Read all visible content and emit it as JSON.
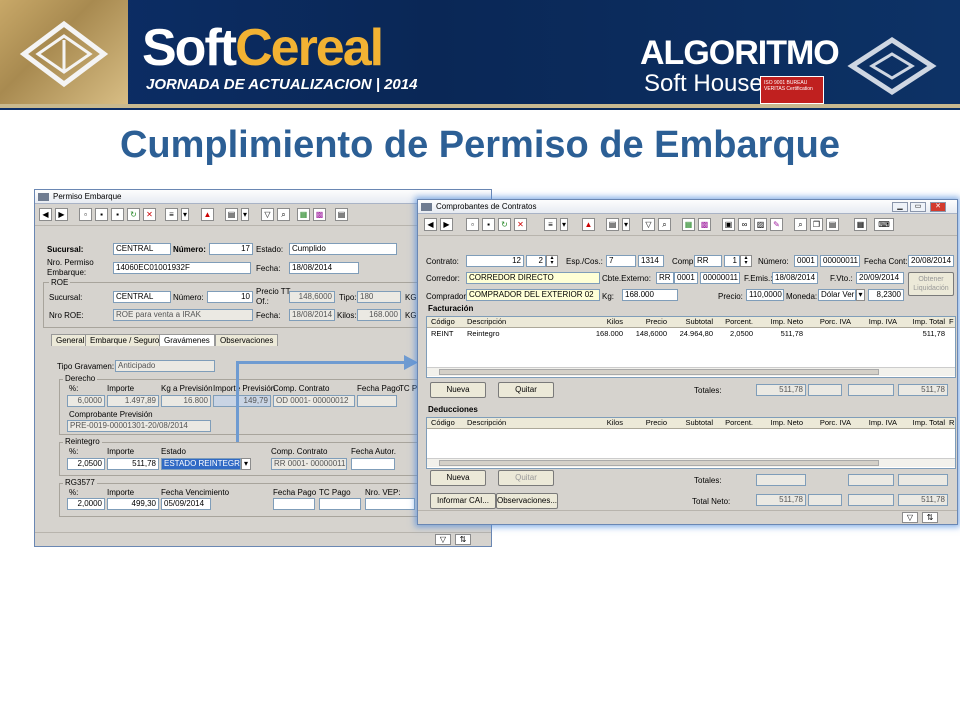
{
  "banner": {
    "brand_soft": "Soft",
    "brand_cereal": "Cereal",
    "subtitle": "JORNADA DE ACTUALIZACION | 2014",
    "partner_name": "ALGORITMO",
    "partner_sub": "Soft House",
    "iso_text": "ISO 9001 BUREAU VERITAS Certification"
  },
  "page_title": "Cumplimiento de Permiso de Embarque",
  "permiso": {
    "title": "Permiso Embarque",
    "sucursal_label": "Sucursal:",
    "sucursal_value": "CENTRAL",
    "numero_label": "Número:",
    "numero_value": "17",
    "estado_label": "Estado:",
    "estado_value": "Cumplido",
    "nro_permiso_label": "Nro. Permiso Embarque:",
    "nro_permiso_value": "14060EC01001932F",
    "fecha_label": "Fecha:",
    "fecha_value": "18/08/2014",
    "roe": {
      "group_label": "ROE",
      "sucursal_label": "Sucursal:",
      "sucursal_value": "CENTRAL",
      "numero_label": "Número:",
      "numero_value": "10",
      "precio_label": "Precio TT Of.:",
      "precio_value": "148,6000",
      "tipo_label": "Tipo:",
      "tipo_value": "180",
      "kg_label": "KG",
      "nro_label": "Nro ROE:",
      "nro_value": "ROE para venta a IRAK",
      "fecha_label": "Fecha:",
      "fecha_value": "18/08/2014",
      "kilos_label": "Kilos:",
      "kilos_value": "168.000",
      "kg2_label": "KG"
    },
    "tabs": [
      "General",
      "Embarque / Seguro",
      "Gravámenes",
      "Observaciones"
    ],
    "tipo_gravamen_label": "Tipo Gravamen:",
    "tipo_gravamen_value": "Anticipado",
    "derecho": {
      "label": "Derecho",
      "headers": [
        "%:",
        "Importe",
        "Kg a Previsión",
        "Importe Previsión",
        "Comp. Contrato",
        "Fecha Pago",
        "TC P"
      ],
      "row": [
        "6,0000",
        "1.497,89",
        "16.800",
        "149,79",
        "OD  0001- 00000012",
        "",
        ""
      ],
      "comp_prev_label": "Comprobante Previsión",
      "comp_prev_value": "PRE-0019-00001301-20/08/2014"
    },
    "reintegro": {
      "label": "Reintegro",
      "headers": [
        "%:",
        "Importe",
        "Estado",
        "Comp. Contrato",
        "Fecha Autor."
      ],
      "row": [
        "2,0500",
        "511,78",
        "ESTADO REINTEGRO",
        "RR  0001- 00000011",
        ""
      ]
    },
    "rg3577": {
      "label": "RG3577",
      "headers": [
        "%:",
        "Importe",
        "Fecha Vencimiento",
        "Fecha Pago",
        "TC Pago",
        "Nro. VEP:"
      ],
      "row": [
        "2,0000",
        "499,30",
        "05/09/2014",
        "",
        "",
        ""
      ]
    }
  },
  "comprobantes": {
    "title": "Comprobantes de Contratos",
    "contrato_label": "Contrato:",
    "contrato_value": "12",
    "contrato_sub": "2",
    "esp_label": "Esp./Cos.:",
    "esp_value": "7",
    "esp_value2": "1314",
    "comp_label": "Comp:",
    "comp_value": "RR",
    "comp_sub": "1",
    "numero_label": "Número:",
    "numero_a": "0001",
    "numero_b": "00000011",
    "fecha_cont_label": "Fecha Cont:",
    "fecha_cont_value": "20/08/2014",
    "corredor_label": "Corredor:",
    "corredor_value": "CORREDOR DIRECTO",
    "cbte_label": "Cbte.Externo:",
    "cbte_a": "RR",
    "cbte_b": "0001",
    "cbte_c": "00000011",
    "femis_label": "F.Emis.:",
    "femis_value": "18/08/2014",
    "fvto_label": "F.Vto.:",
    "fvto_value": "20/09/2014",
    "obtener_label": "Obtener Liquidación",
    "comprador_label": "Comprador:",
    "comprador_value": "COMPRADOR DEL EXTERIOR 02",
    "kg_label": "Kg:",
    "kg_value": "168.000",
    "precio_label": "Precio:",
    "precio_value": "110,0000",
    "moneda_label": "Moneda:",
    "moneda_value": "Dólar Ver",
    "cotiz_value": "8,2300",
    "facturacion_label": "Facturación",
    "fact_headers": [
      "Código",
      "Descripción",
      "Kilos",
      "Precio",
      "Subtotal",
      "Porcent.",
      "Imp. Neto",
      "Porc. IVA",
      "Imp. IVA",
      "Imp. Total",
      "F"
    ],
    "fact_row": [
      "REINT",
      "Reintegro",
      "168.000",
      "148,6000",
      "24.964,80",
      "2,0500",
      "511,78",
      "",
      "",
      "511,78"
    ],
    "nueva_label": "Nueva",
    "quitar_label": "Quitar",
    "totales_label": "Totales:",
    "fact_tot_neto": "511,78",
    "fact_tot_total": "511,78",
    "deducciones_label": "Deducciones",
    "ded_headers": [
      "Código",
      "Descripción",
      "Kilos",
      "Precio",
      "Subtotal",
      "Porcent.",
      "Imp. Neto",
      "Porc. IVA",
      "Imp. IVA",
      "Imp. Total",
      "R"
    ],
    "informar_label": "Informar CAI...",
    "observaciones_label": "Observaciones...",
    "total_neto_label": "Total Neto:",
    "total_neto_value": "511,78",
    "total_total_value": "511,78"
  },
  "colors": {
    "banner": "#0c2f69",
    "accent": "#f2b233",
    "title": "#2c5f95",
    "selection": "#316ac5"
  }
}
